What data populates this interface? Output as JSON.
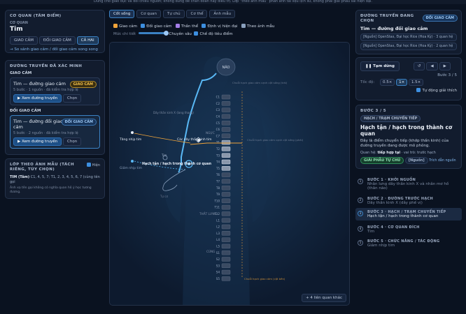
{
  "topbar": "Dùng cho giáo dục và đối chiếu nguồn; không dùng để chẩn đoán hay điều trị. Lớp “theo ảnh mẫu” phản ánh tài liệu lịch sử, không phải giải phẫu sai hiện đại.",
  "left": {
    "organ_panel_title": "CƠ QUAN (TÂM ĐIỂM)",
    "organ_label": "CƠ QUAN",
    "organ_name": "Tim",
    "filters": [
      "GIAO CẢM",
      "ĐỐI GIAO CẢM",
      "CẢ HAI"
    ],
    "compare_link": "→ So sánh giao cảm / đối giao cảm song song",
    "paths_title": "ĐƯỜNG TRUYỀN ĐÃ XÁC MINH",
    "sym_heading": "GIAO CẢM",
    "sym_card": {
      "title": "Tim — đường giao cảm",
      "badge": "GIAO CẢM",
      "meta": "5 bước · 1 nguồn · đã kiểm tra hợp lệ",
      "view_btn": "▶ Xem đường truyền",
      "choose_btn": "Chọn"
    },
    "para_heading": "ĐỐI GIAO CẢM",
    "para_card": {
      "title": "Tim — đường đối giao cảm",
      "badge": "ĐỐI GIAO CẢM",
      "meta": "5 bước · 2 nguồn · đã kiểm tra hợp lệ",
      "view_btn": "▶ Xem đường truyền",
      "choose_btn": "Chọn"
    },
    "layer_title": "LỚP THEO ẢNH MẪU (TÁCH RIÊNG, TÙY CHỌN)",
    "layer_toggle": "Hiện",
    "layer_text1_name": "TIM (Tâm)",
    "layer_text1_rest": " C1, 4, 5, 7; T1, 2, 3, 4, 5, 6, 7 (cùng tên gọi",
    "layer_text2": "Ảnh xạ tên gọi không có nghĩa quan hệ ý học tương đương."
  },
  "center": {
    "tabs": [
      "Cốt sống",
      "Cơ quan",
      "Tự chủ",
      "Cơ thể",
      "Ảnh mẫu"
    ],
    "checks": [
      "Giao cảm",
      "Đối giao cảm",
      "Thần thể",
      "Định vị hiện đại",
      "Theo ảnh mẫu"
    ],
    "detail_label": "Mức chi tiết",
    "detail_value": "Chuyên sâu",
    "focus_label": "Chế độ tiêu điểm",
    "more_btn": "+ 4 liên quan khác",
    "labels": {
      "brain": "NÃO",
      "sym_chain_top": "Chuỗi hạch giao cảm cạnh cột sống (trái)",
      "vagus": "Dây thần kinh X (lang thang)",
      "heart_rate": "Tăng nhịp tim",
      "heart_low": "Giảm nhịp tim",
      "cardiac_nerve": "Các dây thần kinh tim",
      "ganglion": "Hạch tận / hạch trong thành cơ quan",
      "heart": "Tim",
      "heart2": "Tự cơ",
      "ngruc": "NGỰC",
      "thatlung": "THẮT LƯNG",
      "cung": "CÙNG",
      "chain_bottom": "Chuỗi hạch giao cảm (cột bên)",
      "right_chain": "Chuỗi hạch giao cảm cạnh cột sống (phải)",
      "vertebrae": [
        "C1",
        "C2",
        "C3",
        "C4",
        "C5",
        "C6",
        "C7",
        "T1",
        "T2",
        "T3",
        "T4",
        "T5",
        "T6",
        "T7",
        "T8",
        "T9",
        "T10",
        "T11",
        "T12",
        "L1",
        "L2",
        "L3",
        "L4",
        "L5",
        "S1",
        "S2",
        "S3",
        "S4",
        "S5"
      ]
    }
  },
  "right": {
    "title": "ĐƯỜNG TRUYỀN ĐANG CHỌN",
    "badge": "ĐỐI GIAO CẢM",
    "path_name": "Tim — đường đối giao cảm",
    "sources": [
      "[Nguồn] OpenStax, Đại học Rice (Hoa Kỳ) · 3 quan hệ",
      "[Nguồn] OpenStax, Đại học Rice (Hoa Kỳ) · 2 quan hệ"
    ],
    "pause_btn": "❚❚ Tạm dừng",
    "step_counter": "Bước 3 / 5",
    "speed_label": "Tốc độ:",
    "speeds": [
      "0.5×",
      "1×",
      "1.5×"
    ],
    "auto_explain": "Tự động giải thích",
    "current": {
      "step": "BƯỚC 3 / 5",
      "kind": "HẠCH / TRẠM CHUYỂN TIẾP",
      "title": "Hạch tận / hạch trong thành cơ quan",
      "desc": "Đây là điểm chuyển tiếp (khớp thần kinh) của đường truyền đang được mô phỏng.",
      "relation_label": "Quan hệ:",
      "relation_value": "tiếp hợp tại",
      "role_text": "· vai trò: trước hạch",
      "tag_anatomy": "GIẢI PHẪU TỰ CHỦ",
      "tag_source": "[Nguồn]",
      "tag_quote": "Trích dẫn nguồn"
    },
    "steps": [
      {
        "n": "1",
        "title": "BƯỚC 1 · KHỞI NGUỒN",
        "desc": "Nhân lưng dây thần kinh X và nhân mơ hồ (thân não)"
      },
      {
        "n": "2",
        "title": "BƯỚC 2 · ĐƯỜNG TRƯỚC HẠCH",
        "desc": "Dây thần kinh X (dây phế vị)"
      },
      {
        "n": "3",
        "title": "BƯỚC 3 · HẠCH / TRẠM CHUYỂN TIẾP",
        "desc": "Hạch tận / hạch trong thành cơ quan"
      },
      {
        "n": "4",
        "title": "BƯỚC 4 · CƠ QUAN ĐÍCH",
        "desc": "Tim"
      },
      {
        "n": "5",
        "title": "BƯỚC 5 · CHỨC NĂNG / TÁC ĐỘNG",
        "desc": "Giảm nhịp tim"
      }
    ]
  },
  "colors": {
    "sym": "#f0a43a",
    "para": "#59b8f5",
    "accent": "#3b82c4"
  }
}
